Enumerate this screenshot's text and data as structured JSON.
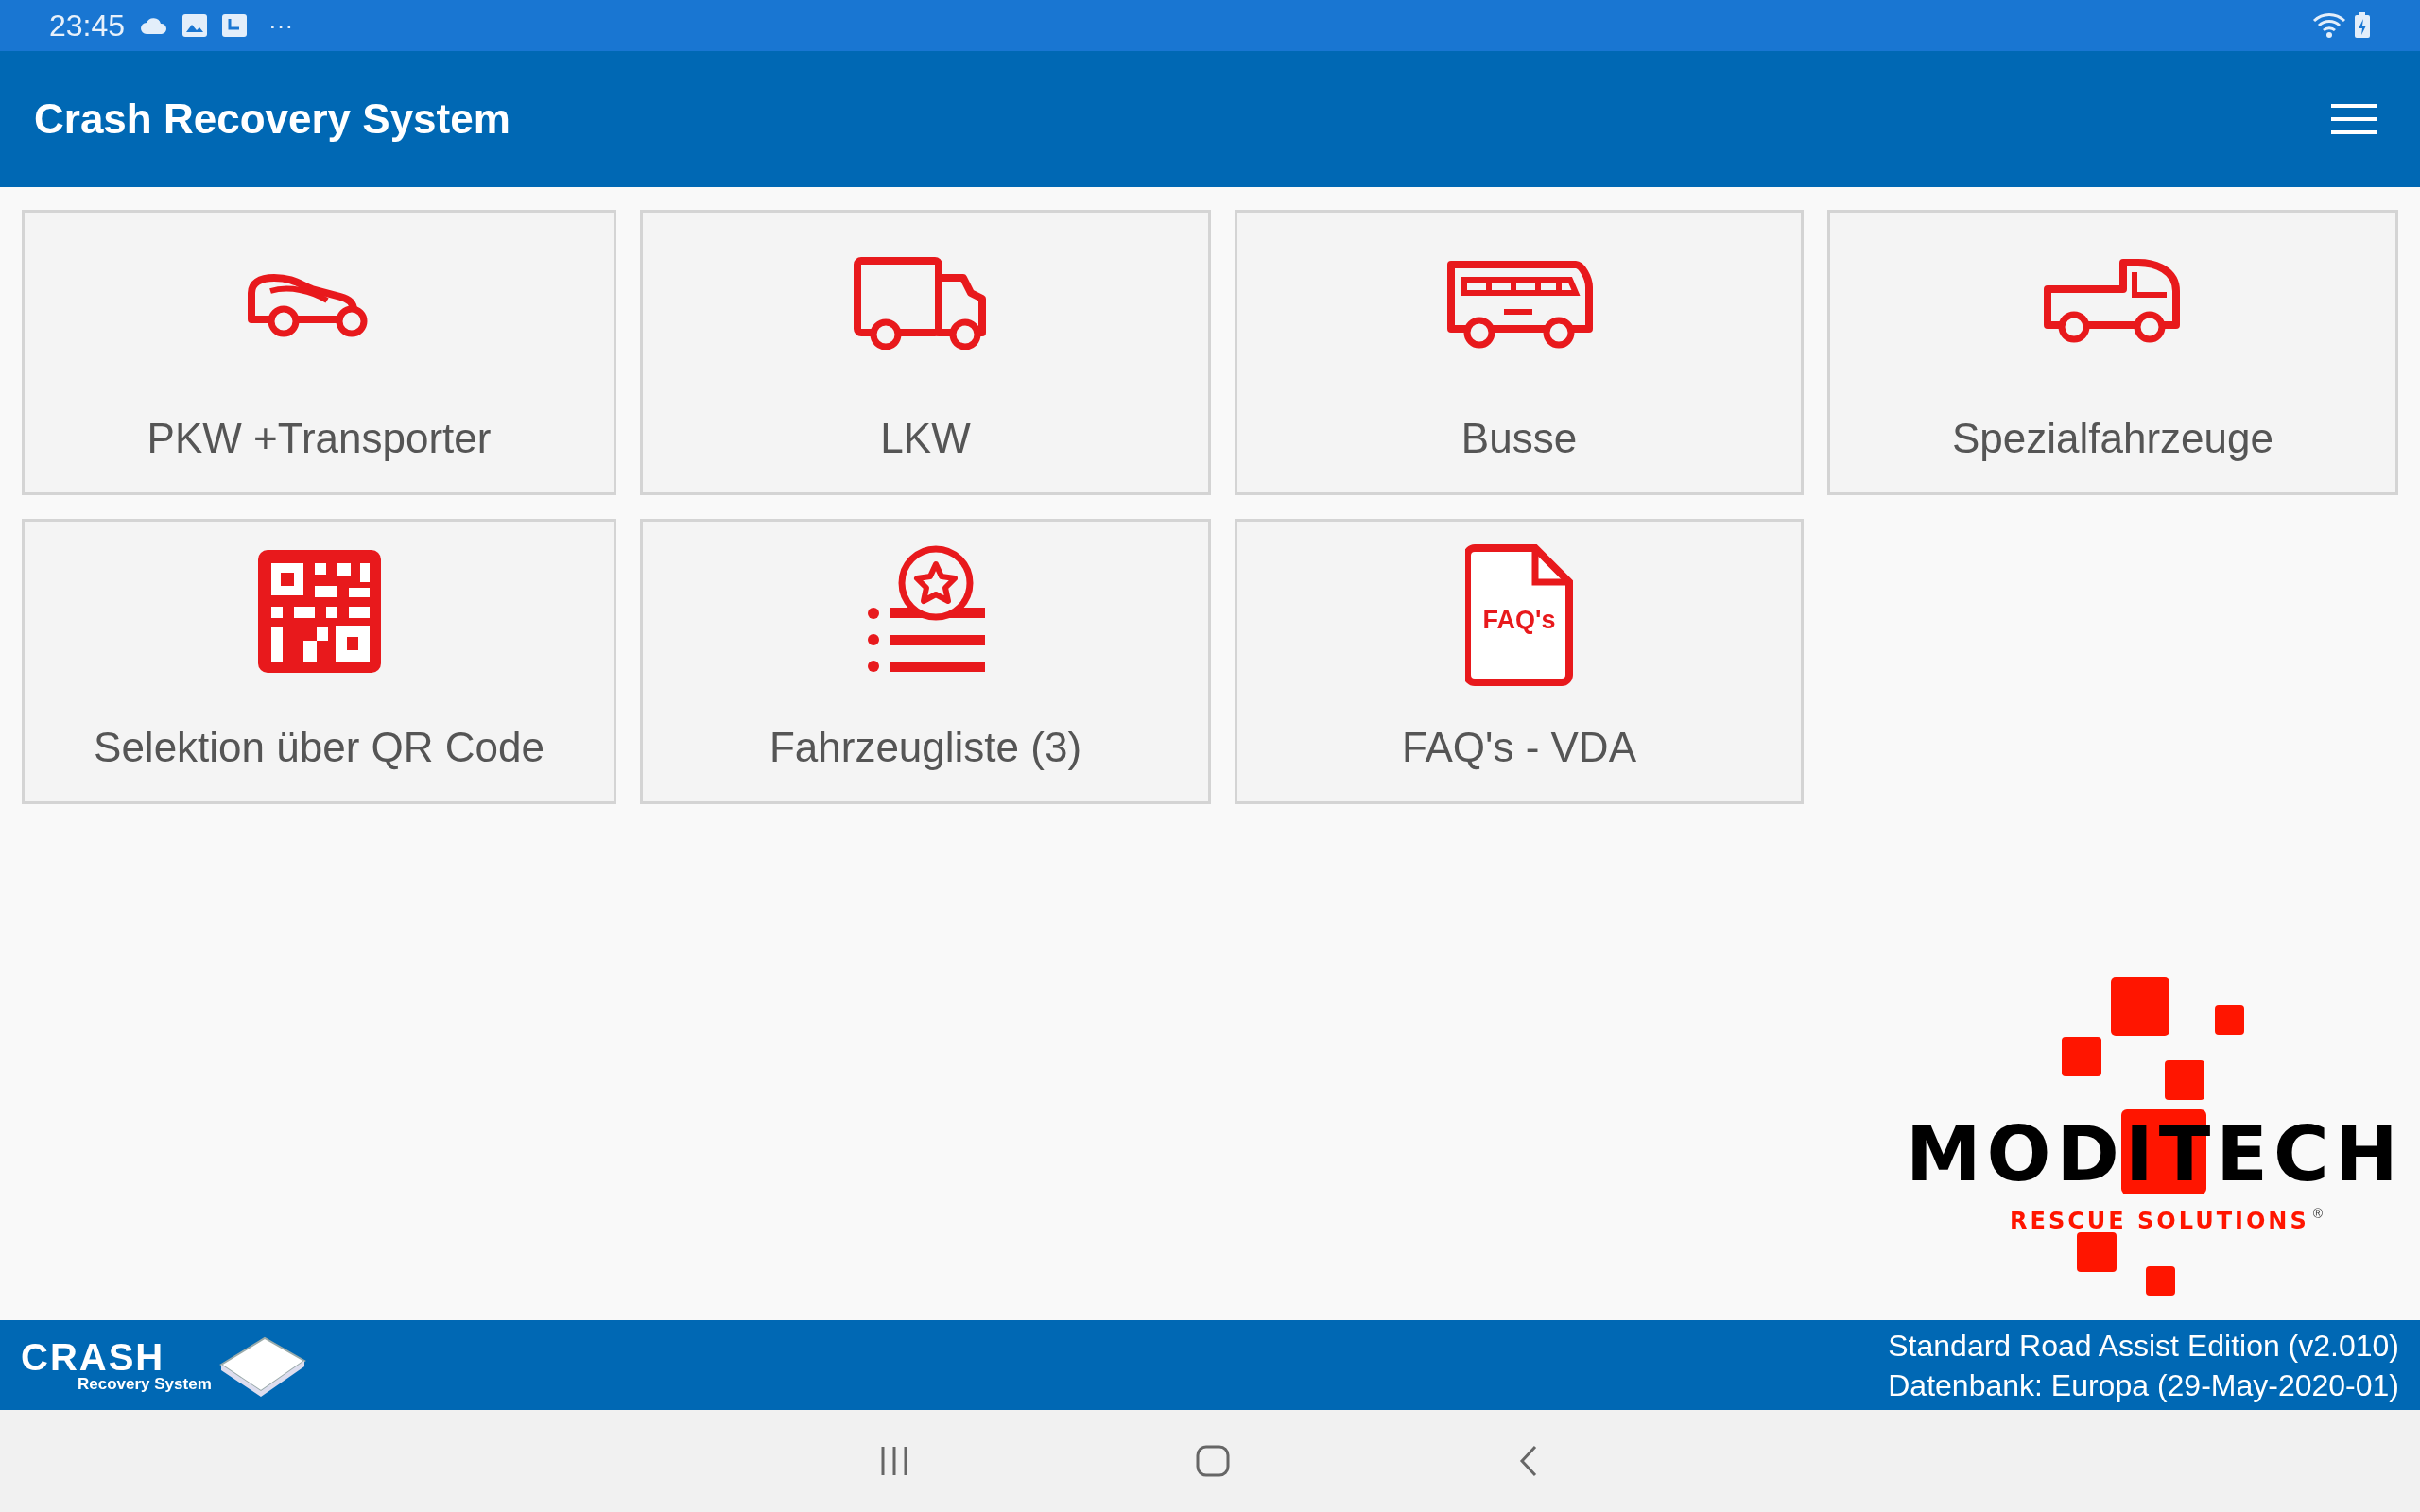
{
  "status_bar": {
    "time": "23:45",
    "more": "···"
  },
  "app_bar": {
    "title": "Crash Recovery System"
  },
  "tiles": [
    {
      "kind": "car",
      "label": "PKW +Transporter"
    },
    {
      "kind": "truck",
      "label": "LKW"
    },
    {
      "kind": "bus",
      "label": "Busse"
    },
    {
      "kind": "pickup",
      "label": "Spezialfahrzeuge"
    },
    {
      "kind": "qr",
      "label": "Selektion über QR Code"
    },
    {
      "kind": "list",
      "label": "Fahrzeugliste (3)"
    },
    {
      "kind": "faq",
      "label": "FAQ's - VDA",
      "icon_text": "FAQ's"
    }
  ],
  "logo": {
    "name": "MODITECH",
    "tagline": "RESCUE SOLUTIONS",
    "mark": "®"
  },
  "footer": {
    "logo_title": "CRASH",
    "logo_subtitle": "Recovery System",
    "edition": "Standard Road Assist Edition (v2.010)",
    "database": "Datenbank: Europa (29-May-2020-01)"
  }
}
